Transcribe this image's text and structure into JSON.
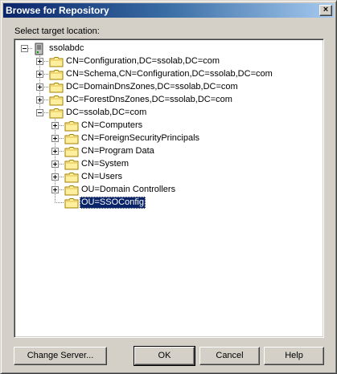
{
  "window": {
    "title": "Browse for Repository",
    "close_glyph": "×"
  },
  "prompt": "Select target location:",
  "tree": {
    "root": {
      "label": "ssolabdc",
      "icon": "server-icon"
    },
    "children": [
      {
        "label": "CN=Configuration,DC=ssolab,DC=com",
        "expander": "plus"
      },
      {
        "label": "CN=Schema,CN=Configuration,DC=ssolab,DC=com",
        "expander": "plus"
      },
      {
        "label": "DC=DomainDnsZones,DC=ssolab,DC=com",
        "expander": "plus"
      },
      {
        "label": "DC=ForestDnsZones,DC=ssolab,DC=com",
        "expander": "plus"
      },
      {
        "label": "DC=ssolab,DC=com",
        "expander": "minus"
      }
    ],
    "grandchildren": [
      {
        "label": "CN=Computers",
        "expander": "plus"
      },
      {
        "label": "CN=ForeignSecurityPrincipals",
        "expander": "plus"
      },
      {
        "label": "CN=Program Data",
        "expander": "plus"
      },
      {
        "label": "CN=System",
        "expander": "plus"
      },
      {
        "label": "CN=Users",
        "expander": "plus"
      },
      {
        "label": "OU=Domain Controllers",
        "expander": "plus"
      },
      {
        "label": "OU=SSOConfig",
        "expander": "none",
        "selected": true
      }
    ]
  },
  "buttons": {
    "change_server": "Change Server...",
    "ok": "OK",
    "cancel": "Cancel",
    "help": "Help"
  },
  "colors": {
    "dialog_bg": "#d4d0c8",
    "titlebar_start": "#0a246a",
    "titlebar_end": "#a6caf0",
    "selection": "#0a246a",
    "folder_fill": "#ffef9c"
  }
}
